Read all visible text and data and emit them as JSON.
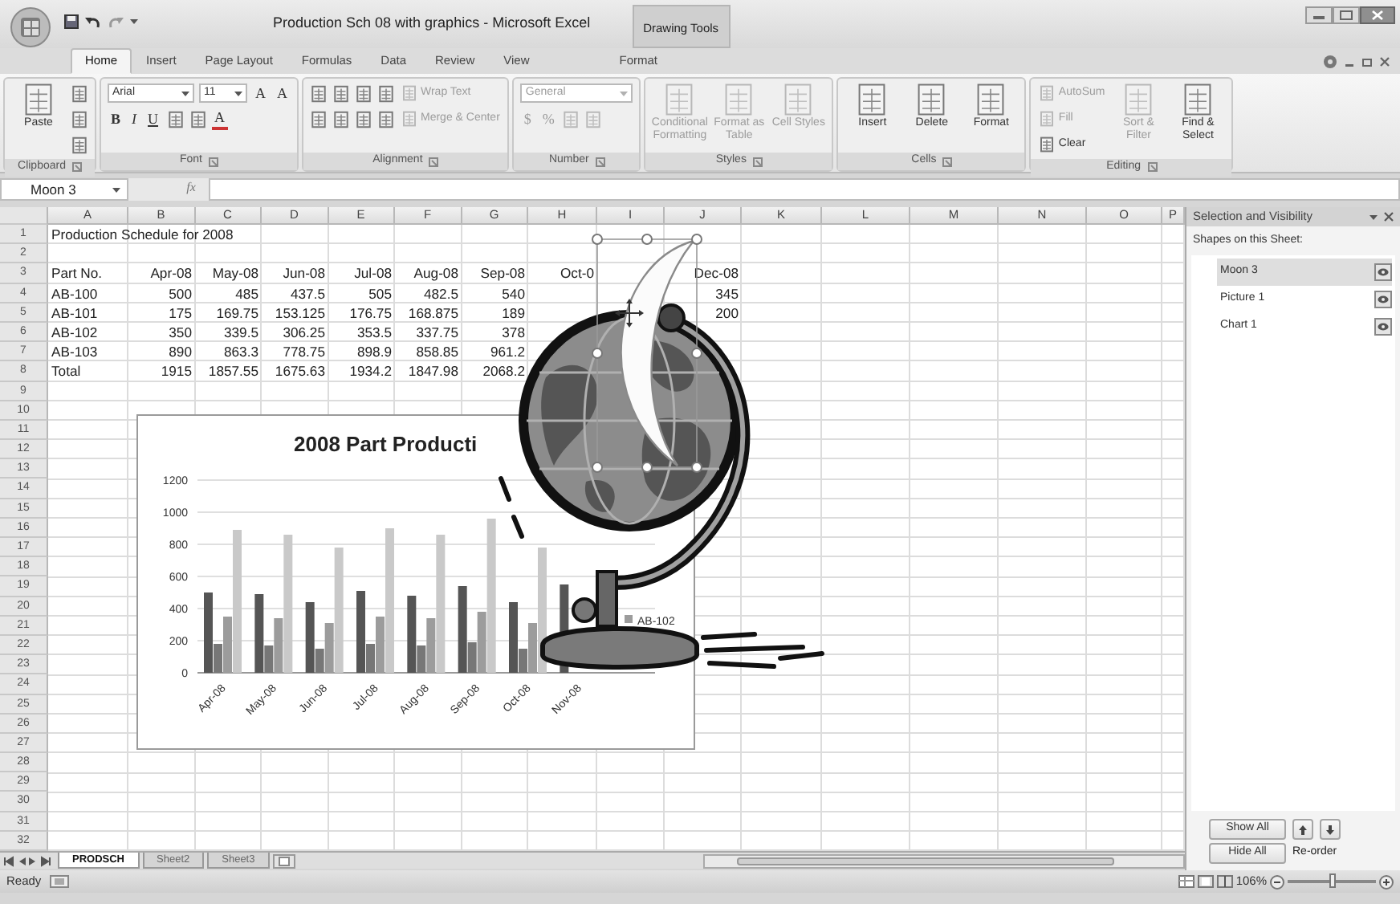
{
  "title_bar": {
    "title": "Production Sch 08 with graphics - Microsoft Excel",
    "context_label": "Drawing Tools"
  },
  "tabs": [
    {
      "label": "Home",
      "selected": true,
      "kind": "main"
    },
    {
      "label": "Insert",
      "selected": false,
      "kind": "main"
    },
    {
      "label": "Page Layout",
      "selected": false,
      "kind": "main"
    },
    {
      "label": "Formulas",
      "selected": false,
      "kind": "main"
    },
    {
      "label": "Data",
      "selected": false,
      "kind": "main"
    },
    {
      "label": "Review",
      "selected": false,
      "kind": "main"
    },
    {
      "label": "View",
      "selected": false,
      "kind": "main"
    },
    {
      "label": "Format",
      "selected": false,
      "kind": "context"
    }
  ],
  "ribbon": [
    {
      "label": "Clipboard",
      "blocks": [
        {
          "kind": "large",
          "text": "Paste",
          "disabled": false
        },
        {
          "kind": "stack",
          "rows": [
            [
              {
                "kind": "icon",
                "disabled": false
              }
            ],
            [
              {
                "kind": "icon",
                "disabled": false
              }
            ],
            [
              {
                "kind": "icon",
                "disabled": false
              }
            ]
          ]
        }
      ]
    },
    {
      "label": "Font",
      "blocks": [
        {
          "kind": "stack",
          "rows": [
            [
              {
                "kind": "combo",
                "text": "Arial",
                "disabled": false
              },
              {
                "kind": "combo",
                "text": "11",
                "disabled": false
              },
              {
                "kind": "glyph",
                "text": "A",
                "disabled": false
              },
              {
                "kind": "glyph",
                "text": "A",
                "disabled": false
              }
            ],
            [
              {
                "kind": "bold",
                "text": "B",
                "disabled": false
              },
              {
                "kind": "italic",
                "text": "I",
                "disabled": false
              },
              {
                "kind": "underline",
                "text": "U",
                "disabled": false
              },
              {
                "kind": "icon",
                "disabled": false
              },
              {
                "kind": "icon",
                "disabled": false
              },
              {
                "kind": "color",
                "text": "A",
                "disabled": false
              }
            ]
          ]
        }
      ]
    },
    {
      "label": "Alignment",
      "blocks": [
        {
          "kind": "stack",
          "rows": [
            [
              {
                "kind": "icon",
                "disabled": false
              },
              {
                "kind": "icon",
                "disabled": false
              },
              {
                "kind": "icon",
                "disabled": false
              },
              {
                "kind": "icon",
                "disabled": false
              },
              {
                "kind": "small",
                "text": "Wrap Text",
                "disabled": true
              }
            ],
            [
              {
                "kind": "icon",
                "disabled": false
              },
              {
                "kind": "icon",
                "disabled": false
              },
              {
                "kind": "icon",
                "disabled": false
              },
              {
                "kind": "icon",
                "disabled": false
              },
              {
                "kind": "small",
                "text": "Merge & Center",
                "disabled": true
              }
            ]
          ]
        }
      ]
    },
    {
      "label": "Number",
      "blocks": [
        {
          "kind": "stack",
          "rows": [
            [
              {
                "kind": "combo",
                "text": "General",
                "disabled": true
              }
            ],
            [
              {
                "kind": "glyph",
                "text": "$",
                "disabled": true
              },
              {
                "kind": "glyph",
                "text": "%",
                "disabled": true
              },
              {
                "kind": "icon",
                "disabled": true
              },
              {
                "kind": "icon",
                "disabled": true
              }
            ]
          ]
        }
      ]
    },
    {
      "label": "Styles",
      "blocks": [
        {
          "kind": "large",
          "text": "Conditional Formatting",
          "disabled": true
        },
        {
          "kind": "large",
          "text": "Format as Table",
          "disabled": true
        },
        {
          "kind": "large",
          "text": "Cell Styles",
          "disabled": true
        }
      ]
    },
    {
      "label": "Cells",
      "blocks": [
        {
          "kind": "large",
          "text": "Insert",
          "disabled": false
        },
        {
          "kind": "large",
          "text": "Delete",
          "disabled": false
        },
        {
          "kind": "large",
          "text": "Format",
          "disabled": false
        }
      ]
    },
    {
      "label": "Editing",
      "blocks": [
        {
          "kind": "stack",
          "rows": [
            [
              {
                "kind": "small",
                "text": "AutoSum",
                "disabled": true
              }
            ],
            [
              {
                "kind": "small",
                "text": "Fill",
                "disabled": true
              }
            ],
            [
              {
                "kind": "small",
                "text": "Clear",
                "disabled": false
              }
            ]
          ]
        },
        {
          "kind": "large",
          "text": "Sort & Filter",
          "disabled": true
        },
        {
          "kind": "large",
          "text": "Find & Select",
          "disabled": false
        }
      ]
    }
  ],
  "formula_bar": {
    "name_box": "Moon 3",
    "function_label": "fx"
  },
  "sheet": {
    "columns": [
      "A",
      "B",
      "C",
      "D",
      "E",
      "F",
      "G",
      "H",
      "I",
      "J",
      "K",
      "L",
      "M",
      "N",
      "O",
      "P"
    ],
    "rows": [
      {
        "number": "1",
        "cells": [
          "Production Schedule for 2008"
        ]
      },
      {
        "number": "2",
        "cells": []
      },
      {
        "number": "3",
        "cells": [
          "Part No.",
          "Apr-08",
          "May-08",
          "Jun-08",
          "Jul-08",
          "Aug-08",
          "Sep-08",
          "Oct-0",
          null,
          "Dec-08"
        ]
      },
      {
        "number": "4",
        "cells": [
          "AB-100",
          "500",
          "485",
          "437.5",
          "505",
          "482.5",
          "540",
          null,
          null,
          "345"
        ]
      },
      {
        "number": "5",
        "cells": [
          "AB-101",
          "175",
          "169.75",
          "153.125",
          "176.75",
          "168.875",
          "189",
          null,
          null,
          "200"
        ]
      },
      {
        "number": "6",
        "cells": [
          "AB-102",
          "350",
          "339.5",
          "306.25",
          "353.5",
          "337.75",
          "378"
        ]
      },
      {
        "number": "7",
        "cells": [
          "AB-103",
          "890",
          "863.3",
          "778.75",
          "898.9",
          "858.85",
          "961.2"
        ]
      },
      {
        "number": "8",
        "cells": [
          "Total",
          "1915",
          "1857.55",
          "1675.63",
          "1934.2",
          "1847.98",
          "2068.2"
        ]
      },
      {
        "number": "9",
        "cells": []
      },
      {
        "number": "10",
        "cells": []
      },
      {
        "number": "11",
        "cells": []
      },
      {
        "number": "12",
        "cells": []
      },
      {
        "number": "13",
        "cells": []
      },
      {
        "number": "14",
        "cells": []
      },
      {
        "number": "15",
        "cells": []
      },
      {
        "number": "16",
        "cells": []
      },
      {
        "number": "17",
        "cells": []
      },
      {
        "number": "18",
        "cells": []
      },
      {
        "number": "19",
        "cells": []
      },
      {
        "number": "20",
        "cells": []
      },
      {
        "number": "21",
        "cells": []
      },
      {
        "number": "22",
        "cells": []
      },
      {
        "number": "23",
        "cells": []
      },
      {
        "number": "24",
        "cells": []
      },
      {
        "number": "25",
        "cells": []
      },
      {
        "number": "26",
        "cells": []
      },
      {
        "number": "27",
        "cells": []
      },
      {
        "number": "28",
        "cells": []
      },
      {
        "number": "29",
        "cells": []
      },
      {
        "number": "30",
        "cells": []
      },
      {
        "number": "31",
        "cells": []
      },
      {
        "number": "32",
        "cells": []
      }
    ]
  },
  "chart": {
    "chart_data": {
      "type": "bar",
      "title": "2008 Part Producti",
      "categories": [
        "Apr-08",
        "May-08",
        "Jun-08",
        "Jul-08",
        "Aug-08",
        "Sep-08",
        "Oct-08",
        "Nov-08"
      ],
      "ylim": [
        0,
        1200
      ],
      "yticks": [
        0,
        200,
        400,
        600,
        800,
        1000,
        1200
      ],
      "grid": true,
      "series": [
        {
          "color": "#555555",
          "values": [
            500,
            490,
            440,
            510,
            480,
            540,
            440,
            550
          ]
        },
        {
          "color": "#777777",
          "values": [
            180,
            170,
            150,
            180,
            170,
            190,
            150,
            null
          ]
        },
        {
          "name": "AB-102",
          "color": "#9c9c9c",
          "values": [
            350,
            340,
            310,
            350,
            340,
            380,
            310,
            null
          ]
        },
        {
          "color": "#c9c9c9",
          "values": [
            890,
            860,
            780,
            900,
            860,
            960,
            780,
            null
          ]
        }
      ]
    }
  },
  "selection_pane": {
    "title": "Selection and Visibility",
    "subtitle": "Shapes on this Sheet:",
    "shapes": [
      {
        "name": "Moon 3",
        "selected": true
      },
      {
        "name": "Picture 1",
        "selected": false
      },
      {
        "name": "Chart 1",
        "selected": false
      }
    ],
    "buttons": [
      "Show All",
      "Hide All"
    ],
    "reorder_label": "Re-order"
  },
  "sheet_tabs": [
    {
      "label": "PRODSCH",
      "selected": true
    },
    {
      "label": "Sheet2",
      "selected": false
    },
    {
      "label": "Sheet3",
      "selected": false
    }
  ],
  "status_bar": {
    "status": "Ready",
    "zoom": "106%",
    "zoom_slider": {
      "level": 0.5
    }
  }
}
